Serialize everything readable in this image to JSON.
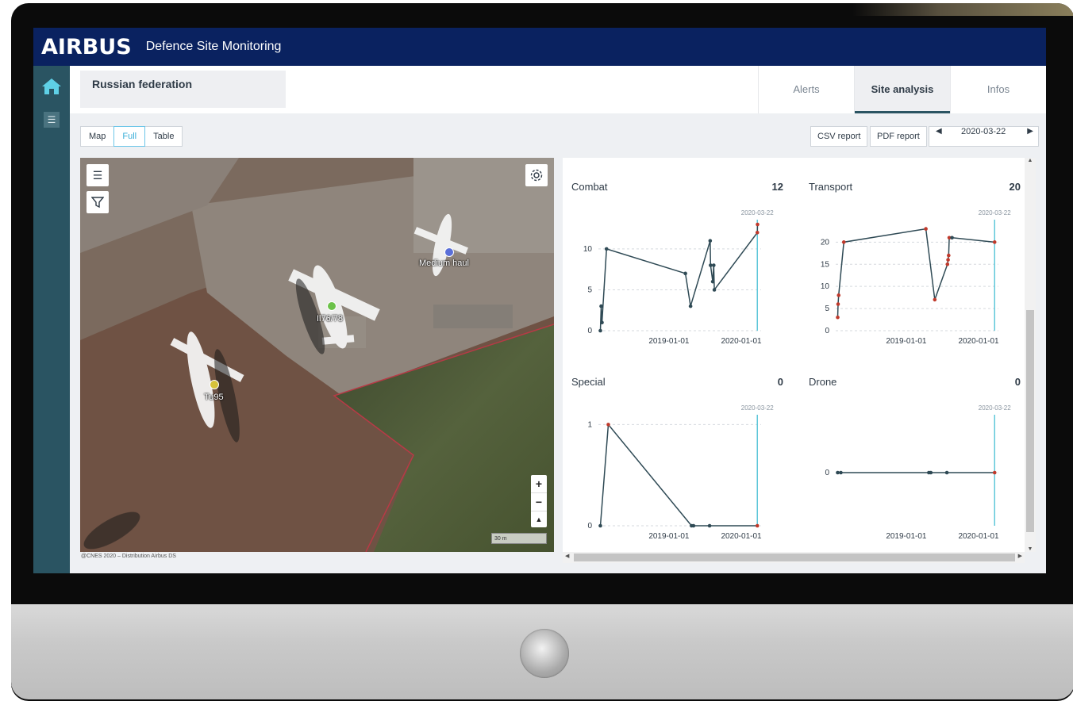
{
  "app": {
    "logo": "AIRBUS",
    "title": "Defence Site Monitoring"
  },
  "site": {
    "name": "Russian federation"
  },
  "tabs": [
    {
      "label": "Alerts",
      "active": false
    },
    {
      "label": "Site analysis",
      "active": true
    },
    {
      "label": "Infos",
      "active": false
    }
  ],
  "view_modes": [
    {
      "label": "Map",
      "active": false
    },
    {
      "label": "Full",
      "active": true
    },
    {
      "label": "Table",
      "active": false
    }
  ],
  "reports": {
    "csv": "CSV report",
    "pdf": "PDF report"
  },
  "date": {
    "current": "2020-03-22",
    "prev_icon": "caret-left-icon",
    "next_icon": "caret-right-icon"
  },
  "map": {
    "credit": "@CNES 2020 – Distribution Airbus DS",
    "scale_label": "30 m",
    "markers": [
      {
        "label": "Medium haul",
        "color": "#5a6fd8"
      },
      {
        "label": "Il76/78",
        "color": "#6cc24a"
      },
      {
        "label": "Tu95",
        "color": "#d6c23a"
      }
    ],
    "controls": {
      "zoom_in": "+",
      "zoom_out": "−",
      "north": "▲"
    }
  },
  "colors": {
    "accent": "#3aaed8",
    "header": "#0a2260",
    "sidebar": "#2a5462",
    "line": "#2f4a55",
    "latest_point": "#c0392b",
    "current_date_line": "#5fc7d9"
  },
  "chart_data": [
    {
      "type": "line",
      "title": "Combat",
      "count": "12",
      "current_date_label": "2020-03-22",
      "x_ticks": [
        "2019-01-01",
        "2020-01-01"
      ],
      "y_ticks": [
        0,
        5,
        10
      ],
      "ylim": [
        0,
        13
      ],
      "x": [
        "2018-01-20",
        "2018-01-24",
        "2018-01-28",
        "2018-02-20",
        "2019-03-25",
        "2019-04-20",
        "2019-07-28",
        "2019-07-30",
        "2019-08-10",
        "2019-08-15",
        "2019-08-18",
        "2020-03-22",
        "2020-03-23"
      ],
      "values": [
        0,
        3,
        1,
        10,
        7,
        3,
        11,
        8,
        6,
        8,
        5,
        12,
        13
      ]
    },
    {
      "type": "line",
      "title": "Transport",
      "count": "20",
      "current_date_label": "2020-03-22",
      "x_ticks": [
        "2019-01-01",
        "2020-01-01"
      ],
      "y_ticks": [
        0,
        5,
        10,
        15,
        20
      ],
      "ylim": [
        0,
        24
      ],
      "x": [
        "2018-01-20",
        "2018-01-22",
        "2018-01-25",
        "2018-02-20",
        "2019-04-10",
        "2019-05-25",
        "2019-07-28",
        "2019-07-31",
        "2019-08-03",
        "2019-08-06",
        "2019-08-20",
        "2020-03-22"
      ],
      "values": [
        3,
        6,
        8,
        20,
        23,
        7,
        15,
        16,
        17,
        21,
        21,
        20
      ]
    },
    {
      "type": "line",
      "title": "Special",
      "count": "0",
      "current_date_label": "2020-03-22",
      "x_ticks": [
        "2019-01-01",
        "2020-01-01"
      ],
      "y_ticks": [
        0,
        1
      ],
      "ylim": [
        0,
        1.05
      ],
      "x": [
        "2018-01-20",
        "2018-03-01",
        "2019-04-25",
        "2019-05-05",
        "2019-07-25",
        "2020-03-22"
      ],
      "values": [
        0,
        1,
        0,
        0,
        0,
        0
      ]
    },
    {
      "type": "line",
      "title": "Drone",
      "count": "0",
      "current_date_label": "2020-03-22",
      "x_ticks": [
        "2019-01-01",
        "2020-01-01"
      ],
      "y_ticks": [
        0
      ],
      "ylim": [
        -1,
        1
      ],
      "x": [
        "2018-01-20",
        "2018-02-05",
        "2019-04-25",
        "2019-05-05",
        "2019-07-25",
        "2020-03-22"
      ],
      "values": [
        0,
        0,
        0,
        0,
        0,
        0
      ]
    }
  ]
}
